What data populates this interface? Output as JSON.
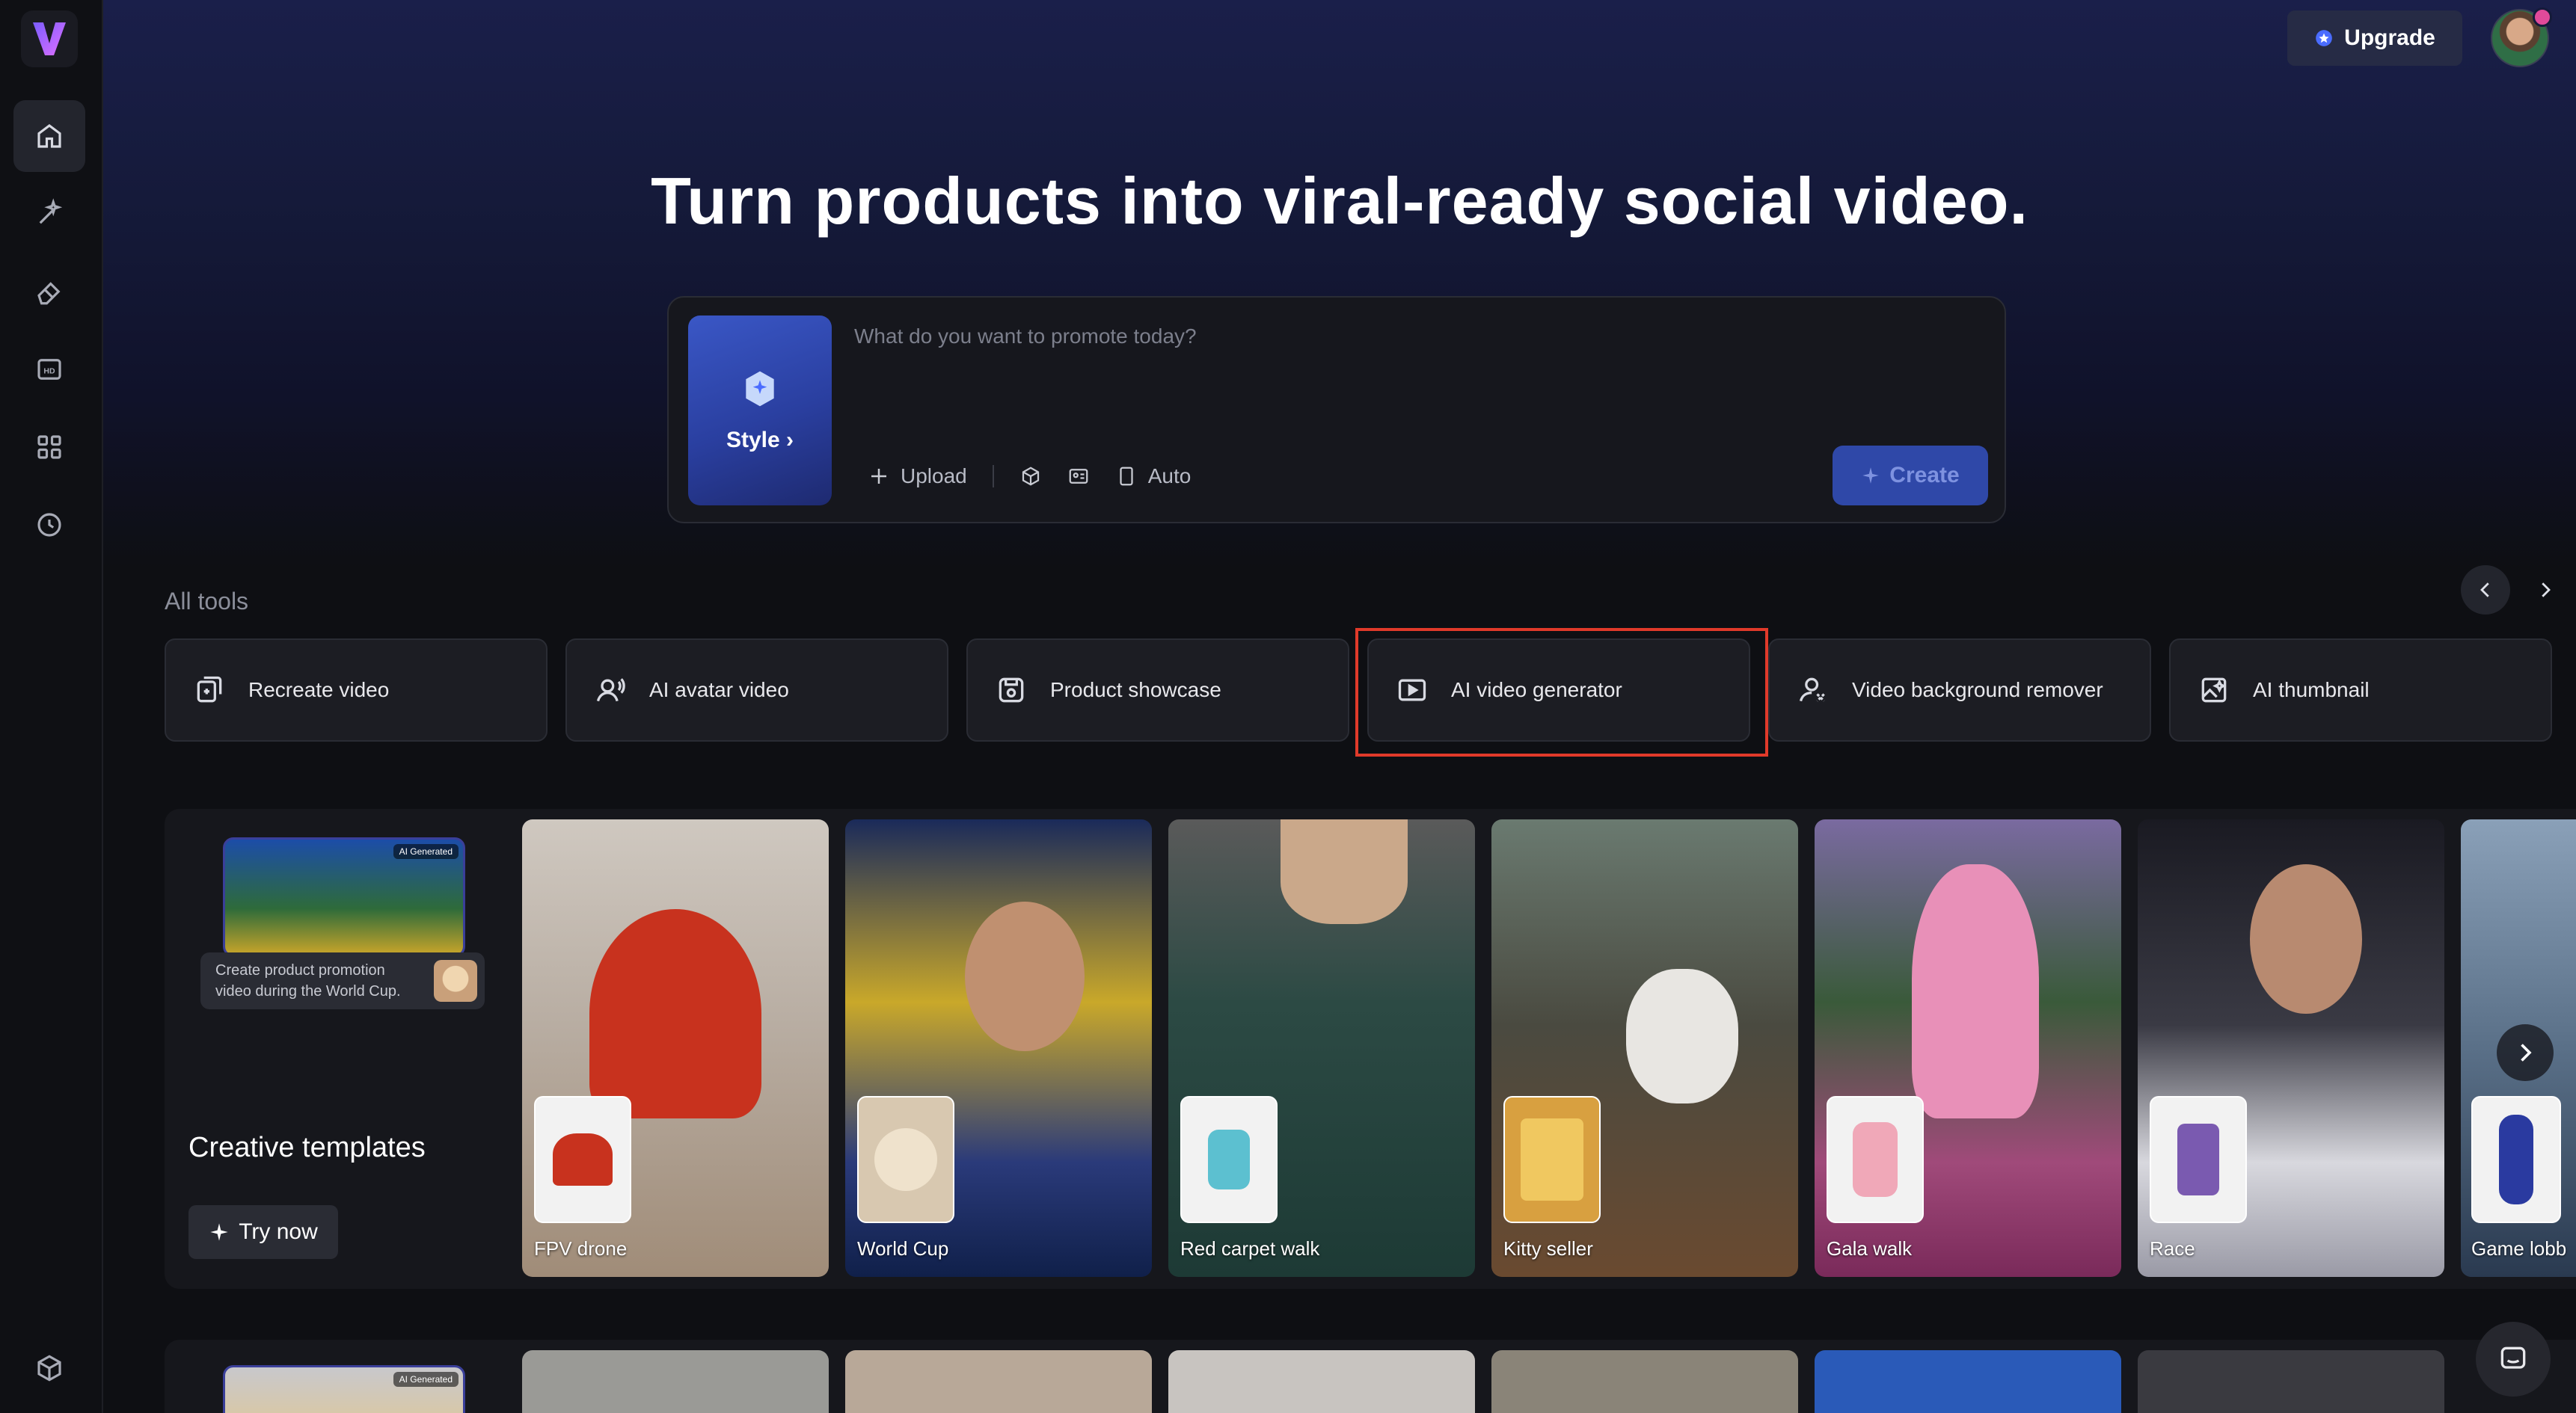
{
  "header": {
    "upgrade_label": "Upgrade",
    "headline": "Turn products into viral-ready social video."
  },
  "sidebar": {
    "items": [
      {
        "name": "home-icon",
        "active": true
      },
      {
        "name": "sparkle-wand-icon",
        "active": false
      },
      {
        "name": "eraser-icon",
        "active": false
      },
      {
        "name": "hd-icon",
        "active": false
      },
      {
        "name": "apps-grid-icon",
        "active": false
      },
      {
        "name": "history-clock-icon",
        "active": false
      }
    ],
    "bottom": {
      "name": "box-icon"
    }
  },
  "prompt": {
    "placeholder": "What do you want to promote today?",
    "style_label": "Style",
    "upload_label": "Upload",
    "auto_label": "Auto",
    "create_label": "Create"
  },
  "tools": {
    "section_label": "All tools",
    "items": [
      {
        "label": "Recreate video",
        "icon": "recreate-icon"
      },
      {
        "label": "AI avatar video",
        "icon": "avatar-voice-icon"
      },
      {
        "label": "Product showcase",
        "icon": "product-showcase-icon"
      },
      {
        "label": "AI video generator",
        "icon": "play-video-icon",
        "highlighted": true
      },
      {
        "label": "Video background remover",
        "icon": "person-remove-icon"
      },
      {
        "label": "AI thumbnail",
        "icon": "image-sparkle-icon"
      }
    ]
  },
  "templates": {
    "title": "Creative templates",
    "try_label": "Try now",
    "promo_badge": "AI Generated",
    "promo_text": "Create product promotion video during the World Cup.",
    "cards": [
      {
        "label": "FPV drone"
      },
      {
        "label": "World Cup"
      },
      {
        "label": "Red carpet walk"
      },
      {
        "label": "Kitty seller"
      },
      {
        "label": "Gala walk"
      },
      {
        "label": "Race"
      },
      {
        "label": "Game lobb"
      }
    ]
  },
  "row2": {
    "badge": "AI Generated"
  },
  "colors": {
    "accent_blue": "#2f48a8",
    "highlight_red": "#e03a2a",
    "panel": "#1c1d23",
    "background": "#0e0f13"
  }
}
